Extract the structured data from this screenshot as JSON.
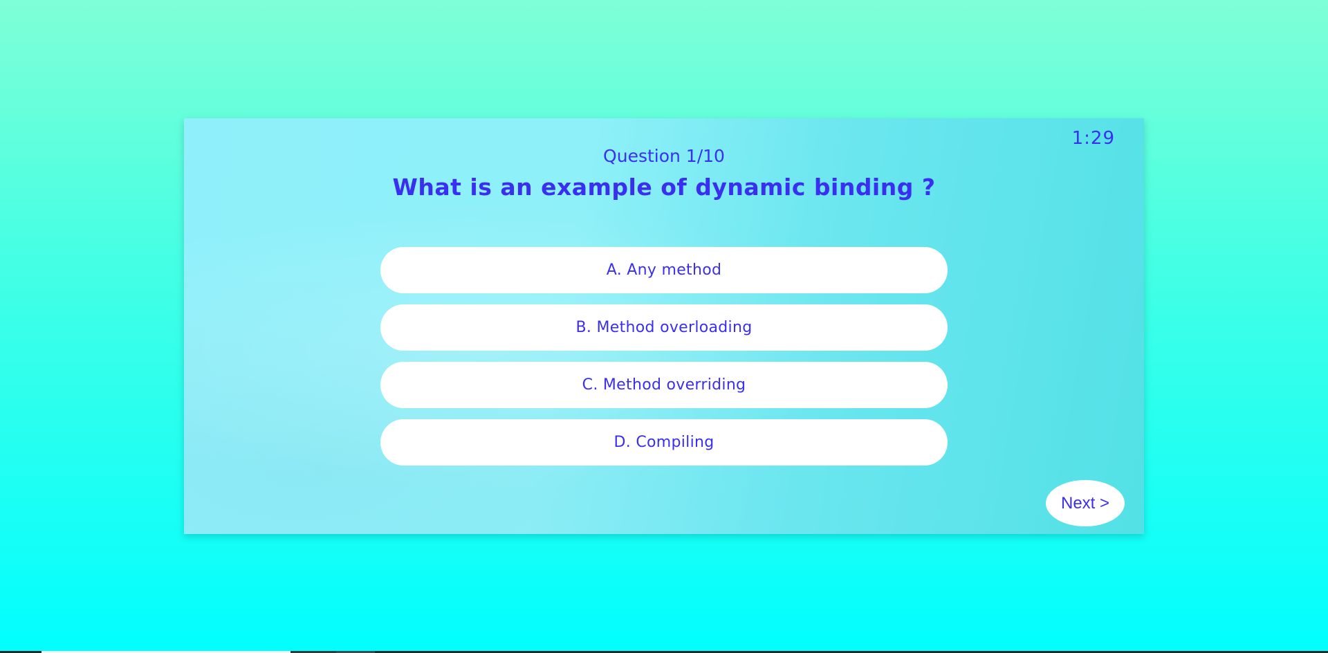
{
  "quiz": {
    "timer": "1:29",
    "counter": "Question 1/10",
    "question": "What is an example of dynamic binding ?",
    "answers": [
      {
        "label": "A. Any method"
      },
      {
        "label": "B. Method overloading"
      },
      {
        "label": "C. Method overriding"
      },
      {
        "label": "D. Compiling"
      }
    ],
    "next_label": "Next >"
  },
  "colors": {
    "text": "#3a2ff0",
    "background_top": "#7fffd6",
    "background_bottom": "#00ffff",
    "button_bg": "#ffffff"
  }
}
